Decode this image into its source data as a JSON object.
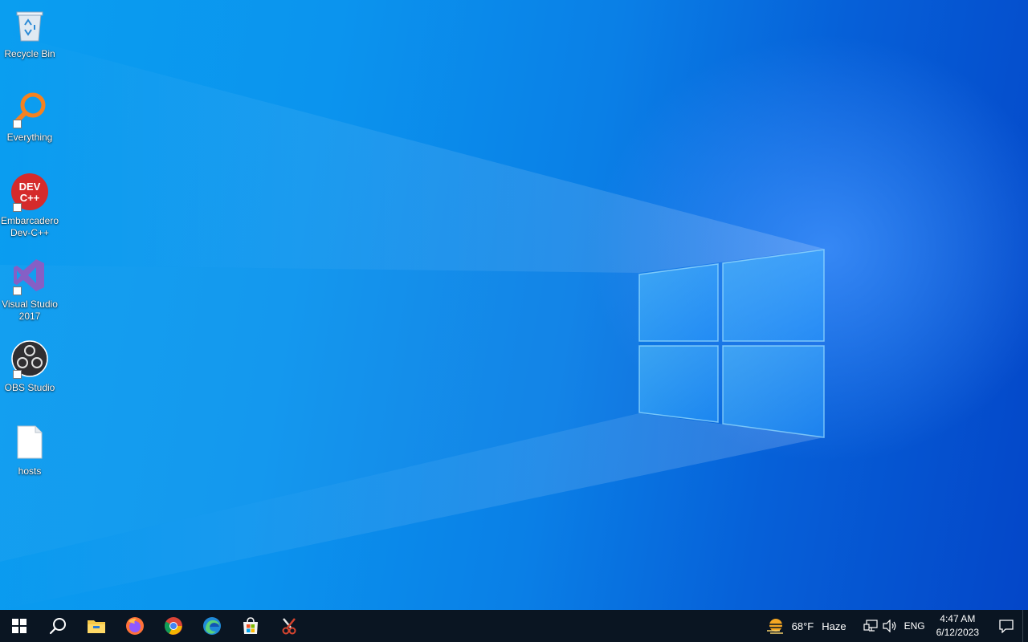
{
  "desktop": {
    "icons": [
      {
        "label": "Recycle Bin",
        "icon": "recycle-bin-icon",
        "shortcut": false
      },
      {
        "label": "Everything",
        "icon": "everything-search-icon",
        "shortcut": true
      },
      {
        "label": "Embarcadero Dev-C++",
        "icon": "devcpp-icon",
        "shortcut": true,
        "logo_text": "DEV C++"
      },
      {
        "label": "Visual Studio 2017",
        "icon": "visual-studio-icon",
        "shortcut": true
      },
      {
        "label": "OBS Studio",
        "icon": "obs-icon",
        "shortcut": true
      },
      {
        "label": "hosts",
        "icon": "file-icon",
        "shortcut": false
      }
    ]
  },
  "taskbar": {
    "pinned": [
      {
        "icon": "windows-start-icon"
      },
      {
        "icon": "search-icon"
      },
      {
        "icon": "file-explorer-icon"
      },
      {
        "icon": "firefox-icon"
      },
      {
        "icon": "chrome-icon"
      },
      {
        "icon": "edge-icon"
      },
      {
        "icon": "microsoft-store-icon"
      },
      {
        "icon": "snipping-tool-icon"
      }
    ],
    "weather": {
      "temperature": "68°F",
      "condition": "Haze",
      "icon": "haze-icon"
    },
    "tray": {
      "network_icon": "network-icon",
      "volume_icon": "volume-icon",
      "language": "ENG"
    },
    "clock": {
      "time": "4:47 AM",
      "date": "6/12/2023"
    },
    "notification_icon": "notification-icon"
  },
  "colors": {
    "taskbar_bg": "#0a1522",
    "wallpaper_primary": "#0a9ef0",
    "wallpaper_secondary": "#0446c8"
  }
}
